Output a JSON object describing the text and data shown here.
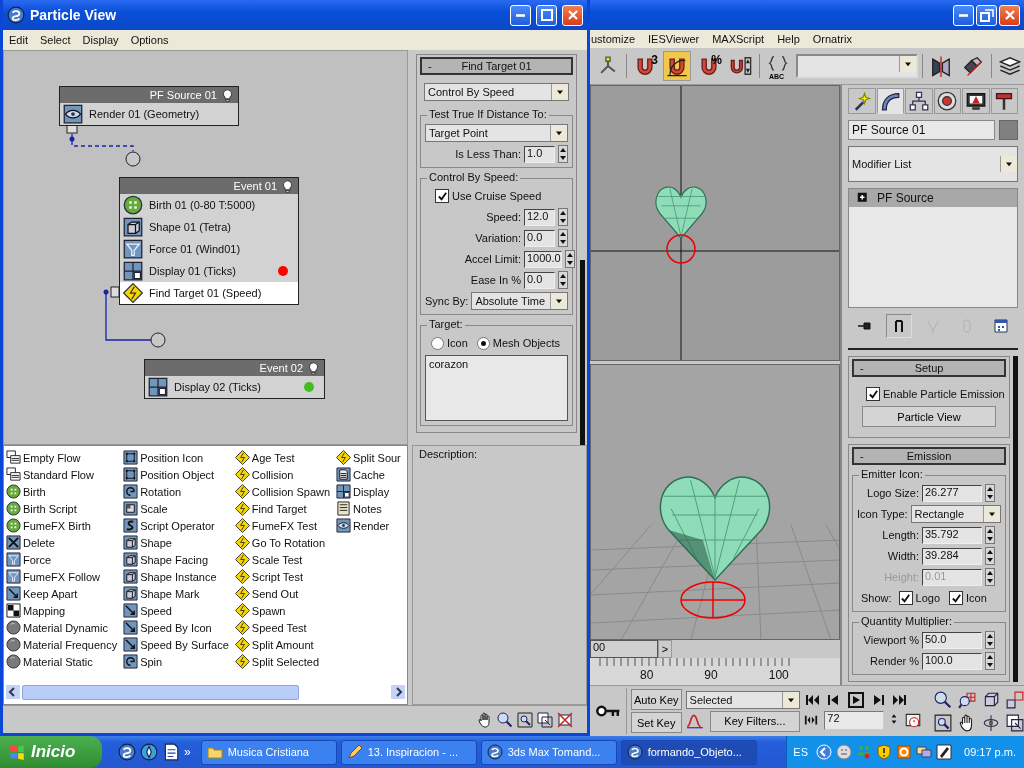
{
  "particle_view": {
    "title": "Particle View",
    "menu": [
      "Edit",
      "Select",
      "Display",
      "Options"
    ],
    "graph": {
      "nodes": [
        {
          "title": "PF Source 01",
          "operators": [
            {
              "label": "Render 01 (Geometry)",
              "kind": "render",
              "selected": false
            }
          ]
        },
        {
          "title": "Event 01",
          "operators": [
            {
              "label": "Birth 01 (0-80 T:5000)",
              "kind": "birth",
              "selected": false
            },
            {
              "label": "Shape 01 (Tetra)",
              "kind": "shape",
              "selected": false
            },
            {
              "label": "Force 01 (Wind01)",
              "kind": "force",
              "selected": false
            },
            {
              "label": "Display 01 (Ticks)",
              "kind": "display",
              "selected": false,
              "color": "#ff0000"
            },
            {
              "label": "Find Target 01 (Speed)",
              "kind": "test",
              "selected": true
            }
          ]
        },
        {
          "title": "Event 02",
          "operators": [
            {
              "label": "Display 02 (Ticks)",
              "kind": "display",
              "selected": false,
              "color": "#44bb22"
            }
          ]
        }
      ]
    },
    "parameters": {
      "rollouts": [
        {
          "toggle": "-",
          "title": "Find Target 01",
          "groups": [
            {
              "items": [
                {
                  "kind": "dropdown",
                  "value": "Control By Speed"
                }
              ]
            },
            {
              "title": "Test True If Distance To:",
              "items": [
                {
                  "kind": "dropdown",
                  "value": "Target Point"
                },
                {
                  "kind": "spinner",
                  "label": "Is Less Than:",
                  "value": "1.0",
                  "disabled": false
                }
              ]
            },
            {
              "title": "Control By Speed:",
              "items": [
                {
                  "kind": "checkbox",
                  "label": "Use Cruise Speed",
                  "checked": true
                },
                {
                  "kind": "spinner",
                  "label": "Speed:",
                  "value": "12.0",
                  "disabled": false
                },
                {
                  "kind": "spinner",
                  "label": "Variation:",
                  "value": "0.0",
                  "disabled": false
                },
                {
                  "kind": "spinner",
                  "label": "Accel Limit:",
                  "value": "1000.0",
                  "disabled": false
                },
                {
                  "kind": "spinner",
                  "label": "Ease In %",
                  "value": "0.0",
                  "disabled": false
                },
                {
                  "kind": "dropdown",
                  "label": "Sync By:",
                  "value": "Absolute Time"
                }
              ]
            },
            {
              "title": "Target:",
              "items": [
                {
                  "kind": "radios",
                  "options": [
                    {
                      "label": "Icon",
                      "selected": false
                    },
                    {
                      "label": "Mesh Objects",
                      "selected": true
                    }
                  ]
                },
                {
                  "kind": "listbox",
                  "entries": [
                    "corazon"
                  ]
                }
              ]
            }
          ]
        }
      ]
    },
    "description": {
      "label": "Description:"
    },
    "depot": {
      "columns": [
        [
          {
            "label": "Empty Flow",
            "kind": "flow"
          },
          {
            "label": "Standard Flow",
            "kind": "flow"
          },
          {
            "label": "Birth",
            "kind": "birth"
          },
          {
            "label": "Birth Script",
            "kind": "birth"
          },
          {
            "label": "FumeFX Birth",
            "kind": "birth"
          },
          {
            "label": "Delete",
            "kind": "delete"
          },
          {
            "label": "Force",
            "kind": "force"
          },
          {
            "label": "FumeFX Follow",
            "kind": "force"
          },
          {
            "label": "Keep Apart",
            "kind": "speed"
          },
          {
            "label": "Mapping",
            "kind": "mapping"
          },
          {
            "label": "Material Dynamic",
            "kind": "material"
          },
          {
            "label": "Material Frequency",
            "kind": "material"
          },
          {
            "label": "Material Static",
            "kind": "material"
          }
        ],
        [
          {
            "label": "Position Icon",
            "kind": "position"
          },
          {
            "label": "Position Object",
            "kind": "position"
          },
          {
            "label": "Rotation",
            "kind": "rotation"
          },
          {
            "label": "Scale",
            "kind": "scale"
          },
          {
            "label": "Script Operator",
            "kind": "script"
          },
          {
            "label": "Shape",
            "kind": "shape"
          },
          {
            "label": "Shape Facing",
            "kind": "shape"
          },
          {
            "label": "Shape Instance",
            "kind": "shape"
          },
          {
            "label": "Shape Mark",
            "kind": "shape"
          },
          {
            "label": "Speed",
            "kind": "speed"
          },
          {
            "label": "Speed By Icon",
            "kind": "speed"
          },
          {
            "label": "Speed By Surface",
            "kind": "speed"
          },
          {
            "label": "Spin",
            "kind": "rotation"
          }
        ],
        [
          {
            "label": "Age Test",
            "kind": "test"
          },
          {
            "label": "Collision",
            "kind": "test"
          },
          {
            "label": "Collision Spawn",
            "kind": "test"
          },
          {
            "label": "Find Target",
            "kind": "test"
          },
          {
            "label": "FumeFX Test",
            "kind": "test"
          },
          {
            "label": "Go To Rotation",
            "kind": "test"
          },
          {
            "label": "Scale Test",
            "kind": "test"
          },
          {
            "label": "Script Test",
            "kind": "test"
          },
          {
            "label": "Send Out",
            "kind": "test"
          },
          {
            "label": "Spawn",
            "kind": "test"
          },
          {
            "label": "Speed Test",
            "kind": "test"
          },
          {
            "label": "Split Amount",
            "kind": "test"
          },
          {
            "label": "Split Selected",
            "kind": "test"
          }
        ],
        [
          {
            "label": "Split Sour",
            "kind": "test"
          },
          {
            "label": "Cache",
            "kind": "cache"
          },
          {
            "label": "Display",
            "kind": "display"
          },
          {
            "label": "Notes",
            "kind": "notes"
          },
          {
            "label": "Render",
            "kind": "render"
          }
        ]
      ]
    }
  },
  "max_window": {
    "menu": [
      "ustomize",
      "IESViewer",
      "MAXScript",
      "Help",
      "Ornatrix"
    ],
    "toolbar": [
      {
        "kind": "axis",
        "selected": false
      },
      {
        "kind": "magnet",
        "mark": "3",
        "selected": false
      },
      {
        "kind": "angle-snap",
        "selected": true
      },
      {
        "kind": "magnet",
        "mark": "%",
        "selected": false
      },
      {
        "kind": "spinner-snap",
        "selected": false
      },
      {
        "kind": "braces",
        "mark": "ABC",
        "selected": false
      },
      {
        "kind": "dropdown",
        "selected": false
      },
      {
        "kind": "mirror",
        "selected": false
      },
      {
        "kind": "align",
        "selected": false
      },
      {
        "kind": "layers",
        "selected": false
      }
    ],
    "command_panel": {
      "tabs": [
        {
          "kind": "wand",
          "selected": false
        },
        {
          "kind": "arc",
          "selected": true
        },
        {
          "kind": "hierarchy",
          "selected": false
        },
        {
          "kind": "wheel",
          "selected": false
        },
        {
          "kind": "monitor",
          "selected": false
        },
        {
          "kind": "hammer",
          "selected": false
        }
      ],
      "object_name": "PF Source 01",
      "modifier_list": "Modifier List",
      "stack": [
        {
          "label": "PF Source",
          "selected": true
        }
      ],
      "stack_tools": [
        {
          "kind": "pin",
          "selected": false,
          "disabled": false
        },
        {
          "kind": "bars",
          "selected": true,
          "disabled": false
        },
        {
          "kind": "fork",
          "selected": false,
          "disabled": true
        },
        {
          "kind": "cylinder",
          "selected": false,
          "disabled": true
        },
        {
          "kind": "window-grid",
          "selected": false,
          "disabled": false
        }
      ],
      "rollouts": [
        {
          "toggle": "-",
          "title": "Setup",
          "groups": [
            {
              "items": [
                {
                  "kind": "checkbox",
                  "label": "Enable Particle Emission",
                  "checked": true
                },
                {
                  "kind": "button",
                  "label": "Particle View"
                }
              ]
            }
          ]
        },
        {
          "toggle": "-",
          "title": "Emission",
          "groups": [
            {
              "title": "Emitter Icon:",
              "items": [
                {
                  "kind": "spinner",
                  "label": "Logo Size:",
                  "value": "26.277",
                  "disabled": false
                },
                {
                  "kind": "dropdown",
                  "label": "Icon Type:",
                  "value": "Rectangle"
                },
                {
                  "kind": "spinner",
                  "label": "Length:",
                  "value": "35.792",
                  "disabled": false
                },
                {
                  "kind": "spinner",
                  "label": "Width:",
                  "value": "39.284",
                  "disabled": false
                },
                {
                  "kind": "spinner",
                  "label": "Height:",
                  "value": "0.01",
                  "disabled": true
                },
                {
                  "kind": "checks",
                  "label": "Show:",
                  "options": [
                    {
                      "label": "Logo",
                      "checked": true
                    },
                    {
                      "label": "Icon",
                      "checked": true
                    }
                  ]
                }
              ]
            },
            {
              "title": "Quantity Multiplier:",
              "items": [
                {
                  "kind": "spinner",
                  "label": "Viewport %",
                  "value": "50.0",
                  "disabled": false
                },
                {
                  "kind": "spinner",
                  "label": "Render %",
                  "value": "100.0",
                  "disabled": false
                }
              ]
            }
          ]
        }
      ]
    },
    "time_slider": {
      "value": "00",
      "next": ">"
    },
    "ruler": [
      "80",
      "90",
      "100"
    ],
    "animation": {
      "auto_key": "Auto Key",
      "set_key": "Set Key",
      "key_mode": "Selected",
      "key_filters": "Key Filters...",
      "frame": "72"
    }
  },
  "taskbar": {
    "start": "Inicio",
    "more": "»",
    "tasks": [
      {
        "label": "Musica Cristiana",
        "kind": "folder",
        "selected": false
      },
      {
        "label": "13. Inspiracion - ...",
        "kind": "pencil",
        "selected": false
      },
      {
        "label": "3ds Max Tomand...",
        "kind": "swirl",
        "selected": false
      },
      {
        "label": "formando_Objeto...",
        "kind": "swirl",
        "selected": true
      }
    ],
    "language": "ES",
    "clock": "09:17 p.m."
  }
}
